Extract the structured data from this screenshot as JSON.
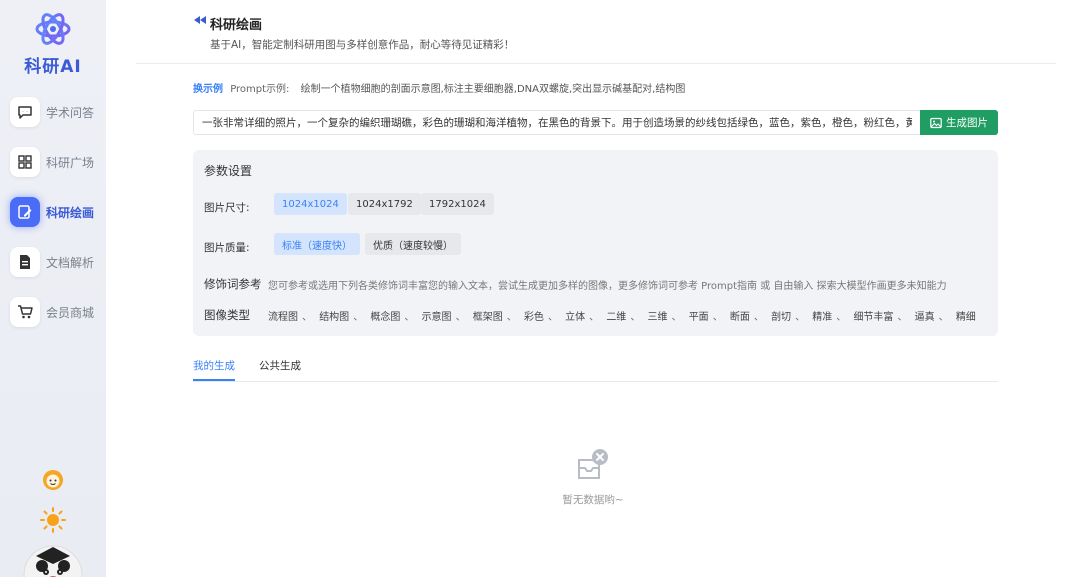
{
  "app": {
    "logo_text": "科研AI"
  },
  "sidebar": {
    "items": [
      {
        "label": "学术问答",
        "icon": "chat-icon",
        "active": false
      },
      {
        "label": "科研广场",
        "icon": "grid-icon",
        "active": false
      },
      {
        "label": "科研绘画",
        "icon": "edit-image-icon",
        "active": true
      },
      {
        "label": "文档解析",
        "icon": "document-icon",
        "active": false
      },
      {
        "label": "会员商城",
        "icon": "cart-icon",
        "active": false
      }
    ]
  },
  "header": {
    "title": "科研绘画",
    "subtitle": "基于AI，智能定制科研用图与多样创意作品，耐心等待见证精彩！"
  },
  "example": {
    "tag": "换示例",
    "label": "Prompt示例:",
    "text": "绘制一个植物细胞的剖面示意图,标注主要细胞器,DNA双螺旋,突出显示碱基配对,结构图"
  },
  "prompt": {
    "value": "一张非常详细的照片，一个复杂的编织珊瑚礁，彩色的珊瑚和海洋植物，在黑色的背景下。用于创造场景的纱线包括绿色，蓝色，紫色，橙色，粉红色，黄色",
    "button_label": "生成图片"
  },
  "params": {
    "title": "参数设置",
    "size_label": "图片尺寸:",
    "sizes": [
      "1024x1024",
      "1024x1792",
      "1792x1024"
    ],
    "selected_size": "1024x1024",
    "quality_label": "图片质量:",
    "qualities": [
      "标准（速度快）",
      "优质（速度较慢）"
    ],
    "selected_quality": "标准（速度快）",
    "modifier_label": "修饰词参考",
    "modifier_desc": "您可参考或选用下列各类修饰词丰富您的输入文本，尝试生成更加多样的图像，更多修饰词可参考 Prompt指南 或 自由输入 探索大模型作画更多未知能力",
    "type_label": "图像类型",
    "types": [
      "流程图",
      "结构图",
      "概念图",
      "示意图",
      "框架图",
      "彩色",
      "立体",
      "二维",
      "三维",
      "平面",
      "断面",
      "剖切",
      "精准",
      "细节丰富",
      "逼真",
      "精细"
    ]
  },
  "tabs": {
    "mine": "我的生成",
    "public": "公共生成"
  },
  "empty": {
    "text": "暂无数据哟~"
  },
  "colors": {
    "accent": "#3b82f6",
    "brand": "#4a6cf7",
    "generate": "#1f9d63"
  }
}
